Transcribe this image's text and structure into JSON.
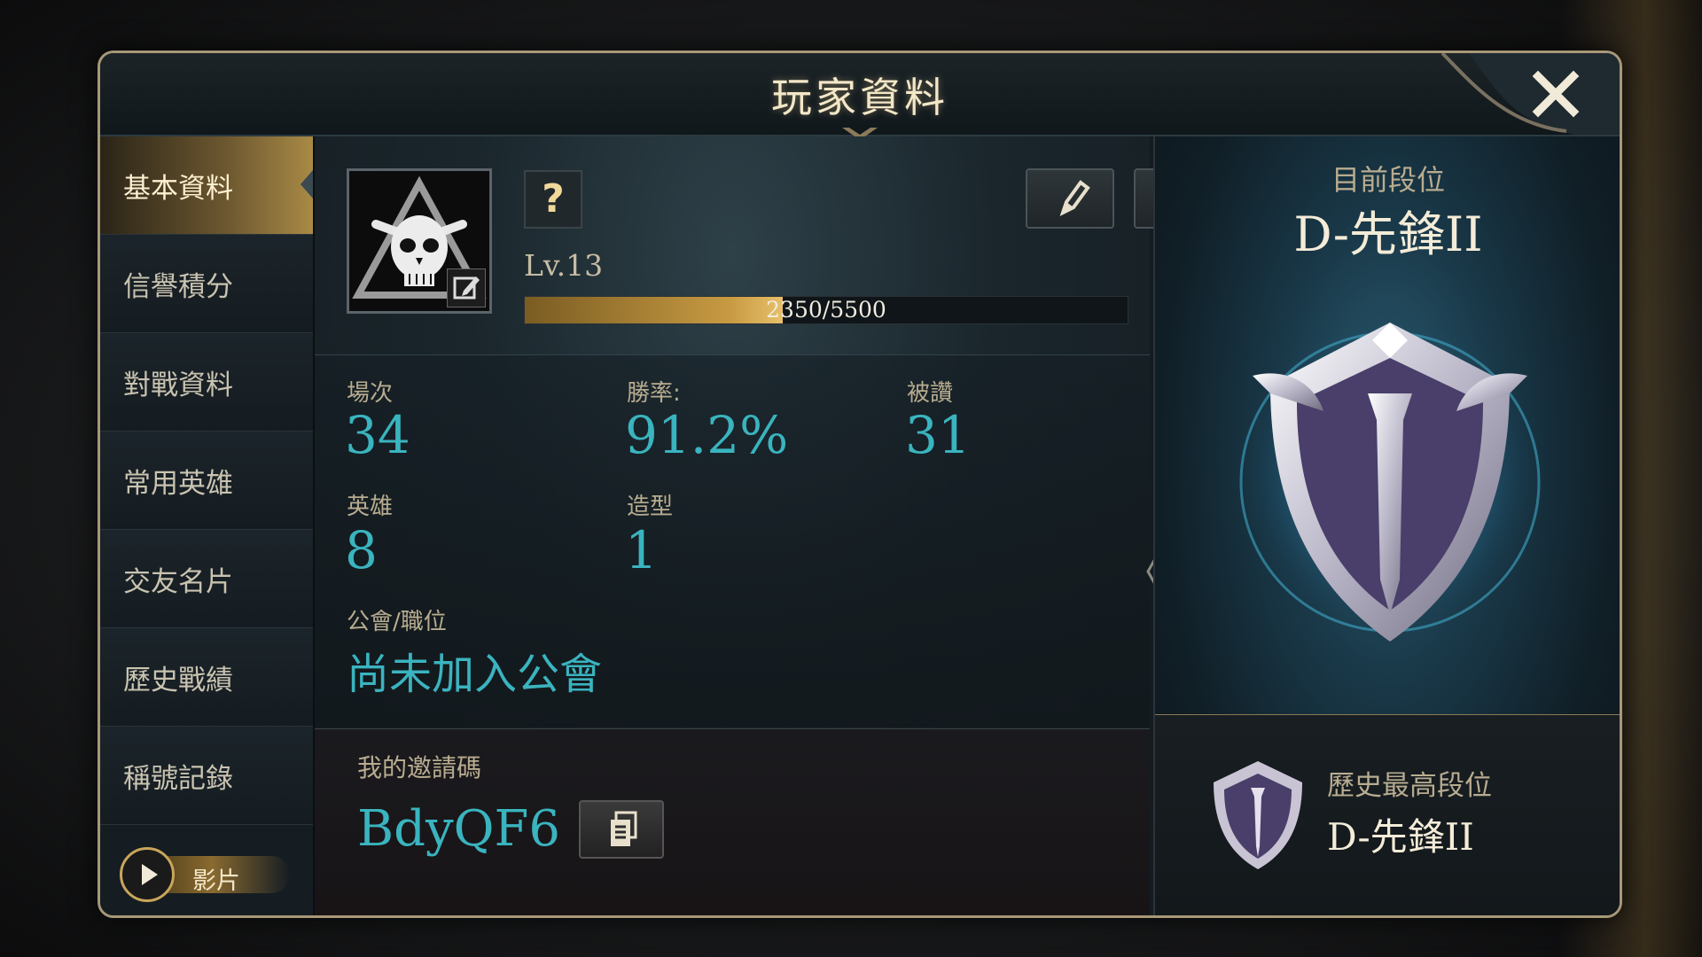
{
  "dialog": {
    "title": "玩家資料"
  },
  "sidebar": {
    "items": [
      {
        "label": "基本資料",
        "active": true
      },
      {
        "label": "信譽積分",
        "active": false
      },
      {
        "label": "對戰資料",
        "active": false
      },
      {
        "label": "常用英雄",
        "active": false
      },
      {
        "label": "交友名片",
        "active": false
      },
      {
        "label": "歷史戰績",
        "active": false
      },
      {
        "label": "稱號記錄",
        "active": false
      }
    ],
    "video_label": "影片"
  },
  "profile": {
    "help_label": "?",
    "level": "Lv.13",
    "xp_text": "2350/5500",
    "xp_current": 2350,
    "xp_max": 5500
  },
  "stats": {
    "matches_label": "場次",
    "matches_value": "34",
    "winrate_label": "勝率:",
    "winrate_value": "91.2%",
    "likes_label": "被讚",
    "likes_value": "31",
    "heroes_label": "英雄",
    "heroes_value": "8",
    "skins_label": "造型",
    "skins_value": "1",
    "guild_label": "公會/職位",
    "guild_value": "尚未加入公會"
  },
  "invite": {
    "label": "我的邀請碼",
    "code": "BdyQF6"
  },
  "rank": {
    "current_label": "目前段位",
    "current_name": "D-先鋒II",
    "history_label": "歷史最高段位",
    "history_name": "D-先鋒II"
  },
  "colors": {
    "accent_teal": "#3ab4bf",
    "gold": "#c89b43",
    "label": "#b8ac90"
  }
}
